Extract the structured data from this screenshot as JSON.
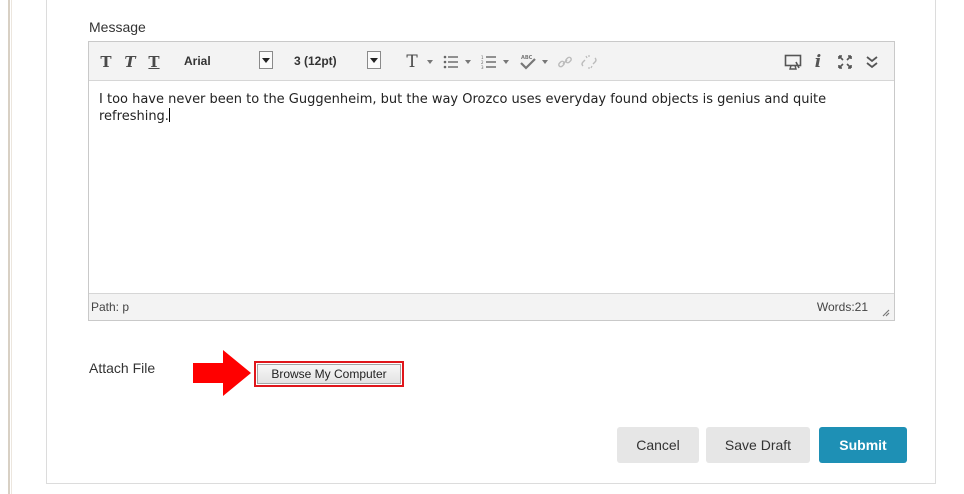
{
  "form": {
    "message_label": "Message",
    "attach_label": "Attach File",
    "browse_button": "Browse My Computer"
  },
  "toolbar": {
    "font_family": "Arial",
    "font_size": "3 (12pt)",
    "icons": [
      "bold-icon",
      "italic-icon",
      "underline-icon",
      "text-color-icon",
      "bullet-list-icon",
      "numbered-list-icon",
      "spellcheck-icon",
      "link-icon",
      "unlink-icon",
      "preview-icon",
      "info-icon",
      "fullscreen-icon",
      "expand-toolbar-icon"
    ]
  },
  "editor": {
    "text": "I too have never been to the Guggenheim, but the way Orozco uses everyday found objects is genius and quite refreshing.",
    "path_label": "Path: p",
    "word_count": "Words:21"
  },
  "actions": {
    "cancel": "Cancel",
    "save_draft": "Save Draft",
    "submit": "Submit"
  },
  "colors": {
    "submit_bg": "#1e90b5",
    "highlight_red": "#e0161b",
    "arrow_red": "#ff0000"
  }
}
